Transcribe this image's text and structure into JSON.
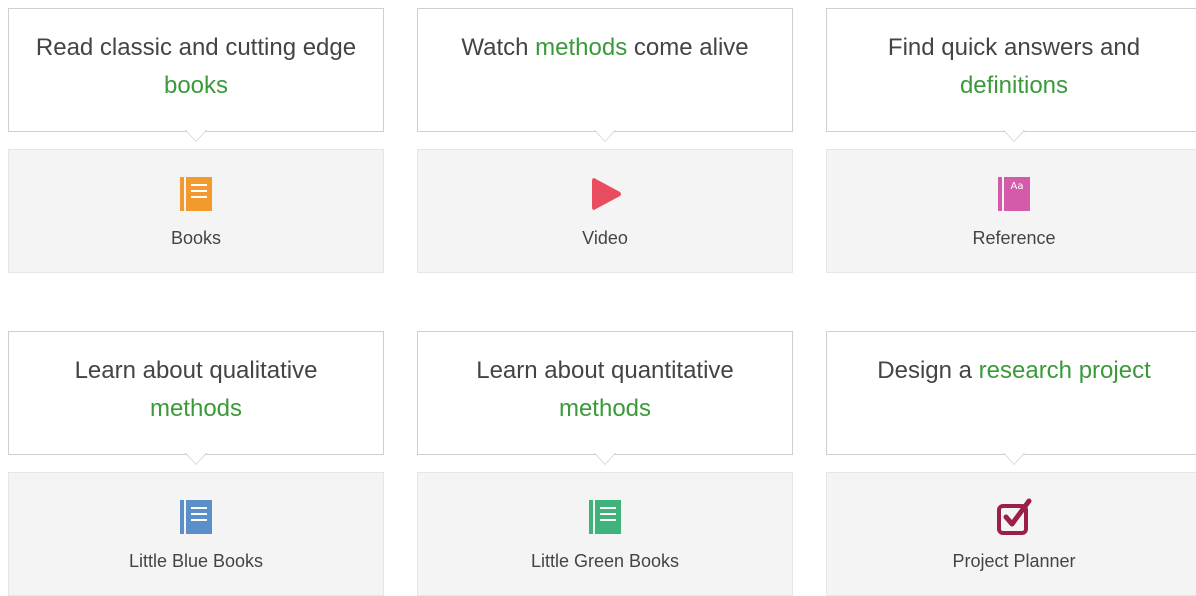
{
  "cards": [
    {
      "bubble": {
        "before": "Read classic and cutting edge ",
        "highlight": "books",
        "after": ""
      },
      "tile": {
        "label": "Books",
        "icon": "book-icon",
        "color": "#f29a2e"
      }
    },
    {
      "bubble": {
        "before": "Watch ",
        "highlight": "methods",
        "after": " come alive"
      },
      "tile": {
        "label": "Video",
        "icon": "play-icon",
        "color": "#ea4c5f"
      }
    },
    {
      "bubble": {
        "before": "Find quick answers and ",
        "highlight": "definitions",
        "after": ""
      },
      "tile": {
        "label": "Reference",
        "icon": "reference-book-icon",
        "color": "#d45aaa",
        "icon_text": "Aa"
      }
    },
    {
      "bubble": {
        "before": "Learn about qualitative ",
        "highlight": "methods",
        "after": ""
      },
      "tile": {
        "label": "Little Blue Books",
        "icon": "book-icon",
        "color": "#5b8fc9"
      }
    },
    {
      "bubble": {
        "before": "Learn about quantitative ",
        "highlight": "methods",
        "after": ""
      },
      "tile": {
        "label": "Little Green Books",
        "icon": "book-icon",
        "color": "#3fb37a"
      }
    },
    {
      "bubble": {
        "before": "Design a ",
        "highlight": "research project",
        "after": ""
      },
      "tile": {
        "label": "Project Planner",
        "icon": "checkbox-icon",
        "color": "#9c1f4a"
      }
    }
  ],
  "colors": {
    "highlight": "#3a9a3a",
    "text": "#444444",
    "tile_background": "#f4f4f4",
    "border": "#cfcfcf"
  }
}
